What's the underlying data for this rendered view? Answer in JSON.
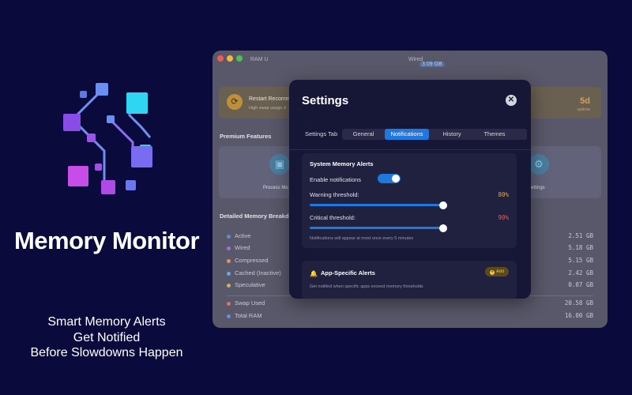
{
  "promo": {
    "app_name": "Memory Monitor",
    "tagline": [
      "Smart Memory Alerts",
      "Get Notified",
      "Before Slowdowns Happen"
    ],
    "logo_icon": "circuit-logo-icon",
    "colors": {
      "background": "#0a0b3c",
      "cyan": "#2ed6f4",
      "violet": "#8f42e6",
      "magenta": "#c74ce8"
    }
  },
  "window": {
    "top_left_text": "RAM U",
    "top_right_text": "Wired",
    "top_right_badge": "3.09 GB",
    "restart_card": {
      "title": "Restart Recomm",
      "subtitle": "High swap usage d",
      "uptime_value": "5d",
      "uptime_label": "uptime"
    },
    "premium_title": "Premium Features",
    "features": [
      {
        "label": "Process Mo",
        "icon": "chip-icon"
      },
      {
        "label": "Settings",
        "icon": "gear-icon"
      }
    ],
    "breakdown_title": "Detailed Memory Breakd",
    "memory_rows": [
      {
        "label": "Active",
        "value": "2.51 GB",
        "color": "#5b8fd6"
      },
      {
        "label": "Wired",
        "value": "5.18 GB",
        "color": "#a26ed8"
      },
      {
        "label": "Compressed",
        "value": "5.15 GB",
        "color": "#e0935b"
      },
      {
        "label": "Cached (Inactive)",
        "value": "2.42 GB",
        "color": "#6aa8e0"
      },
      {
        "label": "Speculative",
        "value": "0.07 GB",
        "color": "#c9b64c"
      }
    ],
    "totals": [
      {
        "label": "Swap Used",
        "value": "20.58 GB",
        "color": "#e07070"
      },
      {
        "label": "Total RAM",
        "value": "16.00 GB",
        "color": "#6a8fd6"
      }
    ]
  },
  "settings": {
    "title": "Settings",
    "tabs_label": "Settings Tab",
    "tabs": [
      "General",
      "Notifications",
      "History",
      "Themes"
    ],
    "active_tab": "Notifications",
    "system_alerts": {
      "title": "System Memory Alerts",
      "enable_label": "Enable notifications",
      "enabled": true,
      "warning_label": "Warning threshold:",
      "warning_value": "80%",
      "warning_level": 0.8,
      "warning_color": "#e8a23a",
      "critical_label": "Critical threshold:",
      "critical_value": "90%",
      "critical_level": 0.9,
      "critical_color": "#ef5a5a",
      "note": "Notifications will appear at most once every 5 minutes"
    },
    "app_alerts": {
      "title": "App-Specific Alerts",
      "add_label": "Add",
      "description": "Get notified when specific apps exceed memory thresholds"
    }
  }
}
